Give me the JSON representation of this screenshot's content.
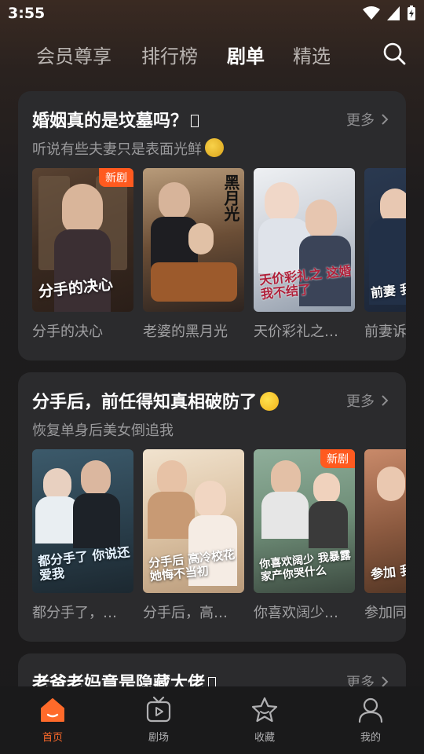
{
  "status_bar": {
    "time": "3:55"
  },
  "top_tabs": [
    {
      "label": "会员尊享",
      "active": false
    },
    {
      "label": "排行榜",
      "active": false
    },
    {
      "label": "剧单",
      "active": true
    },
    {
      "label": "精选",
      "active": false
    }
  ],
  "more_label": "更多",
  "sections": [
    {
      "title": "婚姻真的是坟墓吗？",
      "subtitle": "听说有些夫妻只是表面光鲜",
      "items": [
        {
          "name": "分手的决心",
          "caption": "分手的决心",
          "badge": "新剧"
        },
        {
          "name": "老婆的黑月光",
          "caption": "黑月光",
          "badge": ""
        },
        {
          "name": "天价彩礼之…",
          "caption": "天价彩礼之 这婚我不结了",
          "badge": ""
        },
        {
          "name": "前妻诉",
          "caption": "前妻 我已",
          "badge": ""
        }
      ]
    },
    {
      "title": "分手后，前任得知真相破防了",
      "subtitle": "恢复单身后美女倒追我",
      "items": [
        {
          "name": "都分手了，…",
          "caption": "都分手了 你说还爱我",
          "badge": ""
        },
        {
          "name": "分手后，高…",
          "caption": "分手后 高冷校花 她悔不当初",
          "badge": ""
        },
        {
          "name": "你喜欢阔少…",
          "caption": "你喜欢阔少 我暴露家产你哭什么",
          "badge": "新剧"
        },
        {
          "name": "参加同",
          "caption": "参加 我惊",
          "badge": ""
        }
      ]
    },
    {
      "title": "老爸老妈竟是隐藏大佬",
      "subtitle": "",
      "items": []
    }
  ],
  "bottom_nav": [
    {
      "label": "首页",
      "icon": "home-icon",
      "active": true
    },
    {
      "label": "剧场",
      "icon": "theater-play-icon",
      "active": false
    },
    {
      "label": "收藏",
      "icon": "star-collect-icon",
      "active": false
    },
    {
      "label": "我的",
      "icon": "person-profile-icon",
      "active": false
    }
  ],
  "colors": {
    "accent": "#ff6a2a",
    "badge": "#ff5a1f",
    "card": "#2b2b2d"
  }
}
